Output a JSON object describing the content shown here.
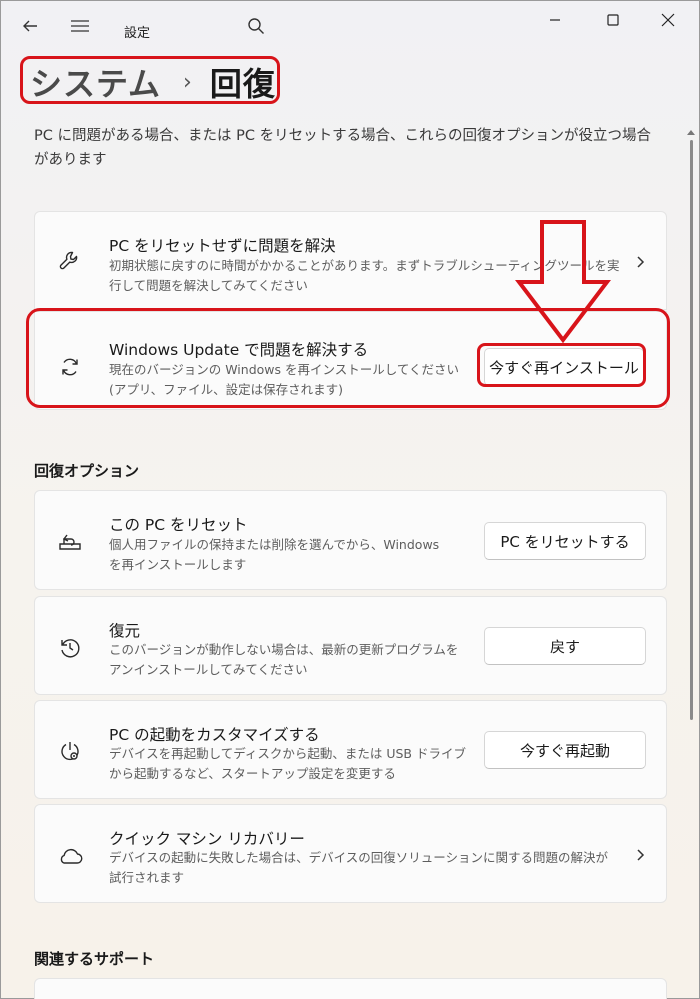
{
  "window": {
    "title": "設定"
  },
  "breadcrumb": {
    "parent": "システム",
    "separator": "›",
    "current": "回復"
  },
  "description": "PC に問題がある場合、または PC をリセットする場合、これらの回復オプションが役立つ場合があります",
  "troubleshoot_cards": [
    {
      "title": "PC をリセットせずに問題を解決",
      "desc_lines": [
        "初期状態に戻すのに時間がかかることがあります。まずトラブルシューティングツールを実",
        "行して問題を解決してみてください"
      ],
      "icon": "wrench-icon"
    },
    {
      "title": "Windows Update で問題を解決する",
      "desc_lines": [
        "現在のバージョンの Windows を再インストールしてください",
        "(アプリ、ファイル、設定は保存されます)"
      ],
      "button": "今すぐ再インストール",
      "icon": "sync-icon"
    }
  ],
  "recovery_section": {
    "title": "回復オプション",
    "items": [
      {
        "title": "この PC をリセット",
        "desc_lines": [
          "個人用ファイルの保持または削除を選んでから、Windows",
          "を再インストールします"
        ],
        "button": "PC をリセットする",
        "icon": "reset-pc-icon"
      },
      {
        "title": "復元",
        "desc_lines": [
          "このバージョンが動作しない場合は、最新の更新プログラムを",
          "アンインストールしてみてください"
        ],
        "button": "戻す",
        "icon": "history-icon"
      },
      {
        "title": "PC の起動をカスタマイズする",
        "desc_lines": [
          "デバイスを再起動してディスクから起動、または USB ドライブ",
          "から起動するなど、スタートアップ設定を変更する"
        ],
        "button": "今すぐ再起動",
        "icon": "startup-gear-icon"
      },
      {
        "title": "クイック マシン リカバリー",
        "desc_lines": [
          "デバイスの起動に失敗した場合は、デバイスの回復ソリューションに関する問題の解決が",
          "試行されます"
        ],
        "icon": "cloud-icon"
      }
    ]
  },
  "related_section": {
    "title": "関連するサポート"
  },
  "colors": {
    "annotation_red": "#d8141a",
    "background": "#f3f1ee",
    "card": "#fbfbfb"
  }
}
